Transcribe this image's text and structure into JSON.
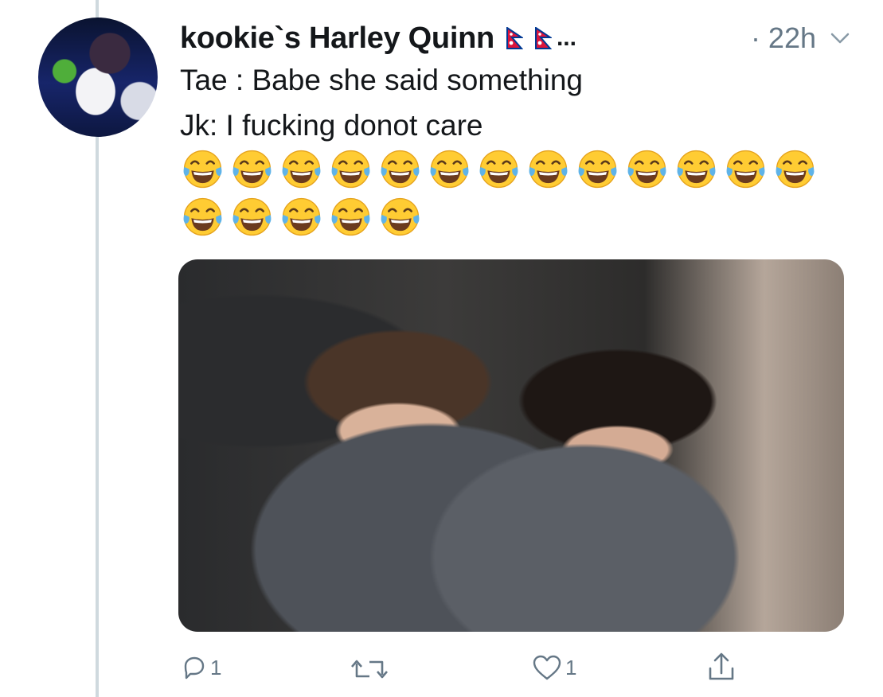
{
  "tweet": {
    "display_name": "kookie`s Harley Quinn",
    "name_suffix": "...",
    "time": "· 22h",
    "lines": [
      "Tae : Babe she said something",
      "Jk: I fucking donot care"
    ],
    "emoji_rows": [
      13,
      5
    ],
    "emoji_name": "face-with-tears-of-joy-icon"
  },
  "actions": {
    "reply_count": "1",
    "retweet_count": "",
    "like_count": "1"
  },
  "colors": {
    "text": "#14171a",
    "muted": "#657786",
    "thread_line": "#cfd9de"
  }
}
